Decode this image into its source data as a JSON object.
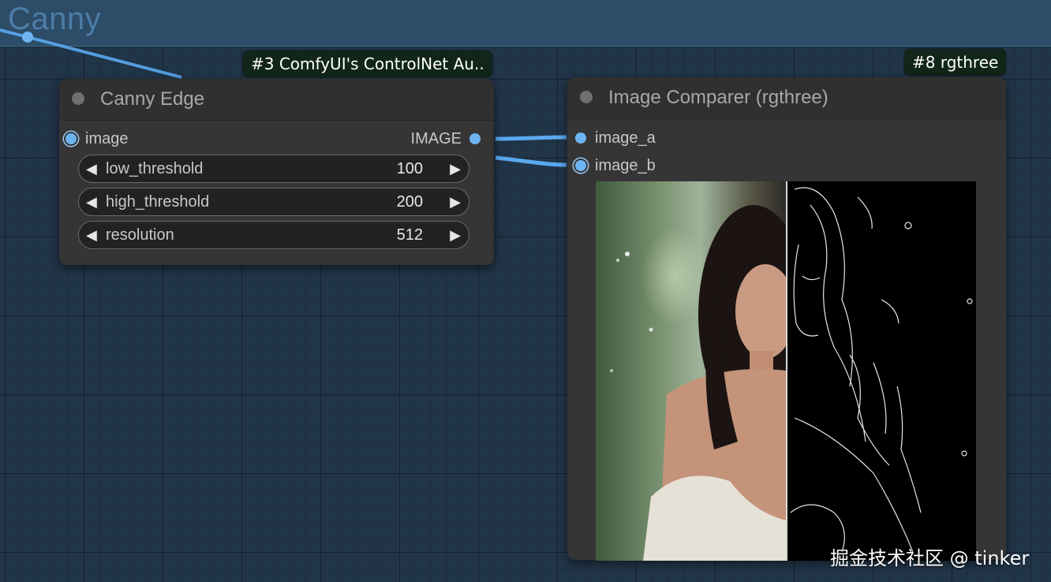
{
  "group": {
    "title": "Canny"
  },
  "badges": {
    "canny_source": "#3 ComfyUI's ControlNet Au..",
    "comparer_source": "#8 rgthree"
  },
  "canny_node": {
    "title": "Canny Edge",
    "input_label": "image",
    "output_label": "IMAGE",
    "widgets": [
      {
        "label": "low_threshold",
        "value": "100"
      },
      {
        "label": "high_threshold",
        "value": "200"
      },
      {
        "label": "resolution",
        "value": "512"
      }
    ],
    "arrow_left": "◀",
    "arrow_right": "▶"
  },
  "comparer_node": {
    "title": "Image Comparer (rgthree)",
    "input_a": "image_a",
    "input_b": "image_b",
    "split_position": 0.5
  },
  "watermark": "掘金技术社区 @ tinker",
  "colors": {
    "link": "#5aa8ef",
    "slot": "#6fb4f2",
    "node_bg": "#353535",
    "canvas_bg": "#1f3143"
  }
}
